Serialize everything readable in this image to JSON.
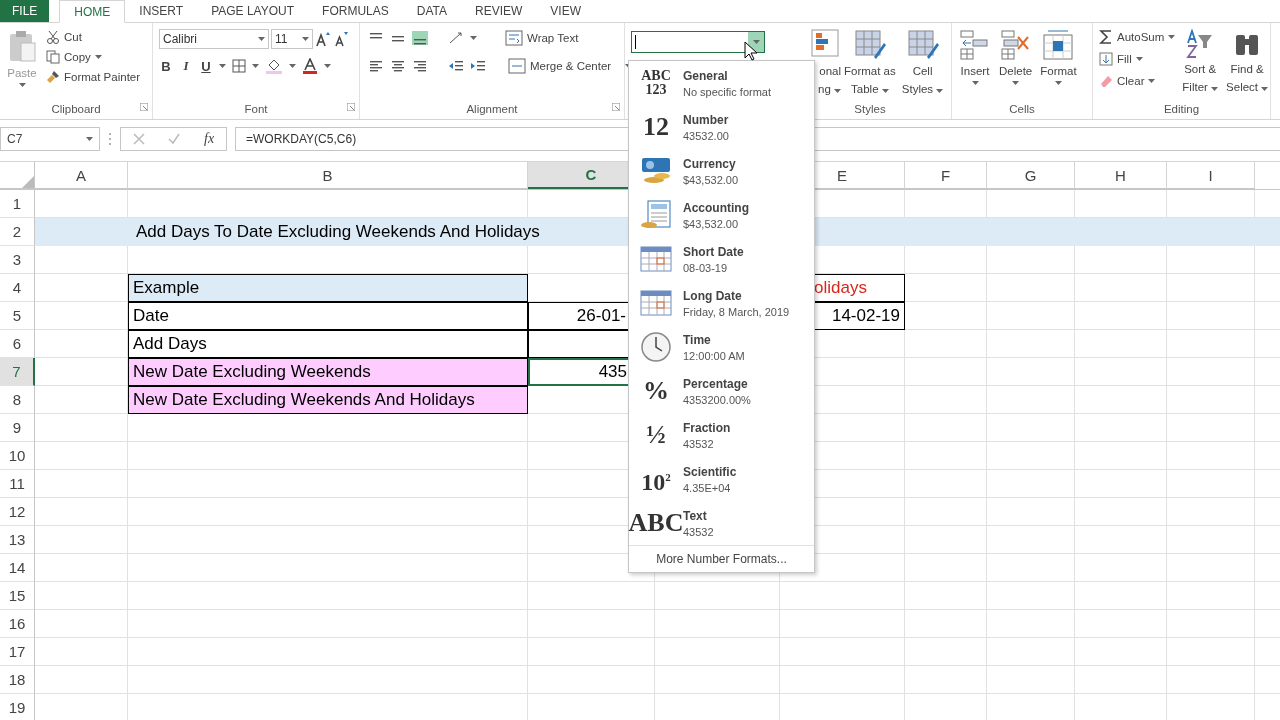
{
  "tabs": [
    {
      "label": "FILE",
      "kind": "file",
      "selected": false
    },
    {
      "label": "HOME",
      "kind": "tab",
      "selected": true
    },
    {
      "label": "INSERT",
      "kind": "tab",
      "selected": false
    },
    {
      "label": "PAGE LAYOUT",
      "kind": "tab",
      "selected": false
    },
    {
      "label": "FORMULAS",
      "kind": "tab",
      "selected": false
    },
    {
      "label": "DATA",
      "kind": "tab",
      "selected": false
    },
    {
      "label": "REVIEW",
      "kind": "tab",
      "selected": false
    },
    {
      "label": "VIEW",
      "kind": "tab",
      "selected": false
    }
  ],
  "clipboard": {
    "paste": "Paste",
    "cut": "Cut",
    "copy": "Copy",
    "format_painter": "Format Painter",
    "label": "Clipboard"
  },
  "font": {
    "name": "Calibri",
    "size": "11",
    "bold": "B",
    "italic": "I",
    "underline": "U",
    "label": "Font"
  },
  "alignment": {
    "wrap_text": "Wrap Text",
    "merge_center": "Merge & Center",
    "label": "Alignment"
  },
  "styles": {
    "conditional_line1": "onal",
    "conditional_line2": "ng",
    "format_table_line1": "Format as",
    "format_table_line2": "Table",
    "cell_styles_line1": "Cell",
    "cell_styles_line2": "Styles",
    "label": "Styles"
  },
  "cells": {
    "insert": "Insert",
    "delete": "Delete",
    "format": "Format",
    "label": "Cells"
  },
  "editing": {
    "autosum": "AutoSum",
    "fill": "Fill",
    "clear": "Clear",
    "sort_line1": "Sort &",
    "sort_line2": "Filter",
    "find_line1": "Find &",
    "find_line2": "Select",
    "label": "Editing"
  },
  "formula_bar": {
    "name_box": "C7",
    "function_symbol": "fx",
    "formula": "=WORKDAY(C5,C6)"
  },
  "number_format_menu": {
    "items": [
      {
        "kind": "glyph",
        "glyph": "ABC 123",
        "name": "General",
        "sample": "No specific format"
      },
      {
        "kind": "glyph",
        "glyph": "12",
        "name": "Number",
        "sample": "43532.00"
      },
      {
        "kind": "currency",
        "name": "Currency",
        "sample": "$43,532.00"
      },
      {
        "kind": "accounting",
        "name": "Accounting",
        "sample": "$43,532.00"
      },
      {
        "kind": "calendar",
        "name": "Short Date",
        "sample": "08-03-19"
      },
      {
        "kind": "calendar",
        "name": "Long Date",
        "sample": "Friday, 8 March, 2019"
      },
      {
        "kind": "clock",
        "name": "Time",
        "sample": "12:00:00 AM"
      },
      {
        "kind": "glyph",
        "glyph": "%",
        "name": "Percentage",
        "sample": "4353200.00%"
      },
      {
        "kind": "glyph",
        "glyph": "½",
        "name": "Fraction",
        "sample": "43532"
      },
      {
        "kind": "glyph",
        "glyph": "10$^{2}$",
        "name": "Scientific",
        "sample": "4.35E+04"
      },
      {
        "kind": "glyph",
        "glyph": "ABC",
        "name": "Text",
        "sample": "43532"
      }
    ],
    "footer": "More Number Formats..."
  },
  "sheet": {
    "columns": [
      {
        "label": "A",
        "selected": false
      },
      {
        "label": "B",
        "selected": false
      },
      {
        "label": "C",
        "selected": true
      },
      {
        "label": "E",
        "selected": false
      },
      {
        "label": "F",
        "selected": false
      },
      {
        "label": "G",
        "selected": false
      },
      {
        "label": "H",
        "selected": false
      },
      {
        "label": "I",
        "selected": false
      }
    ],
    "rows": [
      {
        "label": "1",
        "selected": false
      },
      {
        "label": "2",
        "selected": false,
        "band": true,
        "b": {
          "text": "Add Days To Date Excluding Weekends And Holidays",
          "kind": "title",
          "selected": false
        }
      },
      {
        "label": "3",
        "selected": false
      },
      {
        "label": "4",
        "selected": false,
        "b": {
          "text": "Example",
          "kind": "header",
          "selected": false
        },
        "e": {
          "text": "olidays",
          "kind": "accent",
          "selected": false
        }
      },
      {
        "label": "5",
        "selected": false,
        "b": {
          "text": "Date",
          "kind": "bordered",
          "selected": false
        },
        "c": {
          "text": "26-01-",
          "kind": "bordered",
          "selected": false
        },
        "e": {
          "text": "14-02-19",
          "kind": "bordered",
          "selected": false
        }
      },
      {
        "label": "6",
        "selected": false,
        "b": {
          "text": "Add Days",
          "kind": "bordered",
          "selected": false
        },
        "c": {
          "kind": "bordered",
          "selected": false
        }
      },
      {
        "label": "7",
        "selected": true,
        "b": {
          "text": "New Date Excluding Weekends",
          "kind": "pink",
          "selected": false
        },
        "c": {
          "text": "435",
          "kind": "plain",
          "selected": true
        }
      },
      {
        "label": "8",
        "selected": false,
        "b": {
          "text": "New Date Excluding Weekends And Holidays",
          "kind": "pink",
          "selected": false
        }
      },
      {
        "label": "9",
        "selected": false
      },
      {
        "label": "10",
        "selected": false
      },
      {
        "label": "11",
        "selected": false
      },
      {
        "label": "12",
        "selected": false
      },
      {
        "label": "13",
        "selected": false
      },
      {
        "label": "14",
        "selected": false
      },
      {
        "label": "15",
        "selected": false
      },
      {
        "label": "16",
        "selected": false
      },
      {
        "label": "17",
        "selected": false
      },
      {
        "label": "18",
        "selected": false
      },
      {
        "label": "19",
        "selected": false
      }
    ]
  }
}
